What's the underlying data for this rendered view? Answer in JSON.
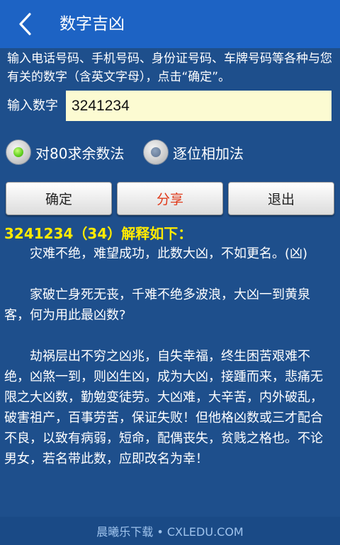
{
  "header": {
    "title": "数字吉凶"
  },
  "intro_text": "输入电话号码、手机号码、身份证号码、车牌号码等各种与您有关的数字（含英文字母），点击“确定”。",
  "input": {
    "label": "输入数字",
    "value": "3241234"
  },
  "methods": [
    {
      "label": "对80求余数法",
      "selected": true
    },
    {
      "label": "逐位相加法",
      "selected": false
    }
  ],
  "buttons": {
    "confirm": "确定",
    "share": "分享",
    "exit": "退出"
  },
  "result": {
    "heading": "3241234（34）解释如下：",
    "paragraphs": [
      "灾难不绝，难望成功，此数大凶，不如更名。(凶)",
      "家破亡身死无丧，千难不绝多波浪，大凶一到黄泉客，何为用此最凶数?",
      "劫祸层出不穷之凶兆，自失幸福，终生困苦艰难不绝，凶煞一到，则凶生凶，成为大凶，接踵而来，悲痛无限之大凶数，勤勉变徒劳。大凶难，大辛苦，内外破乱，破害祖产，百事劳苦，保证失败！但他格凶数或三才配合不良，以致有病弱，短命，配偶丧失，贫贱之格也。不论男女，若名带此数，应即改名为幸！"
    ]
  },
  "footer": "晨曦乐下载 • CXLEDU.COM",
  "colors": {
    "background": "#1e4f8c",
    "titlebar": "#1d63c4",
    "heading_yellow": "#ffea00",
    "input_bg": "#fcfbd2",
    "share_red": "#e03a1a",
    "radio_on": "#5fcf1e"
  }
}
